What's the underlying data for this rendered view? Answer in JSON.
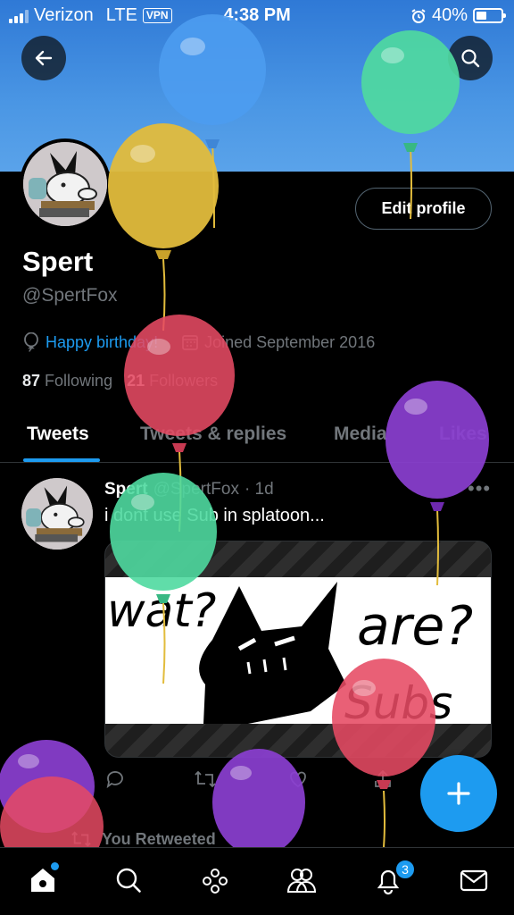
{
  "status_bar": {
    "carrier": "Verizon",
    "network": "LTE",
    "vpn": "VPN",
    "time": "4:38 PM",
    "battery": "40%"
  },
  "profile": {
    "name": "Spert",
    "handle": "@SpertFox",
    "bio_link": "Happy birthday!",
    "joined": "Joined September 2016",
    "following_count": "87",
    "following_label": "Following",
    "followers_count": "21",
    "followers_label": "Followers",
    "edit_button": "Edit profile"
  },
  "tabs": [
    {
      "label": "Tweets",
      "active": true
    },
    {
      "label": "Tweets & replies",
      "active": false
    },
    {
      "label": "Media",
      "active": false
    },
    {
      "label": "Likes",
      "active": false
    }
  ],
  "tweet": {
    "name": "Spert",
    "handle": "@SpertFox",
    "time": "· 1d",
    "text": "i dont use Sub in splatoon...",
    "more": "•••",
    "image_text_left": "wat?",
    "image_text_right": "are?",
    "image_text_bottom": "Subs"
  },
  "retweet_banner": "You Retweeted",
  "fab_icon": "plus-icon",
  "nav": {
    "notifications_badge": "3",
    "items": [
      "home-icon",
      "search-icon",
      "spaces-icon",
      "communities-icon",
      "notifications-icon",
      "messages-icon"
    ]
  },
  "colors": {
    "accent": "#1d9bf0",
    "banner": "#3d88dd",
    "balloon_blue": "#4d9cf0",
    "balloon_green": "#4fd9a0",
    "balloon_yellow": "#e2bc3c",
    "balloon_red": "#e64a63",
    "balloon_purple": "#8b3fd1"
  }
}
